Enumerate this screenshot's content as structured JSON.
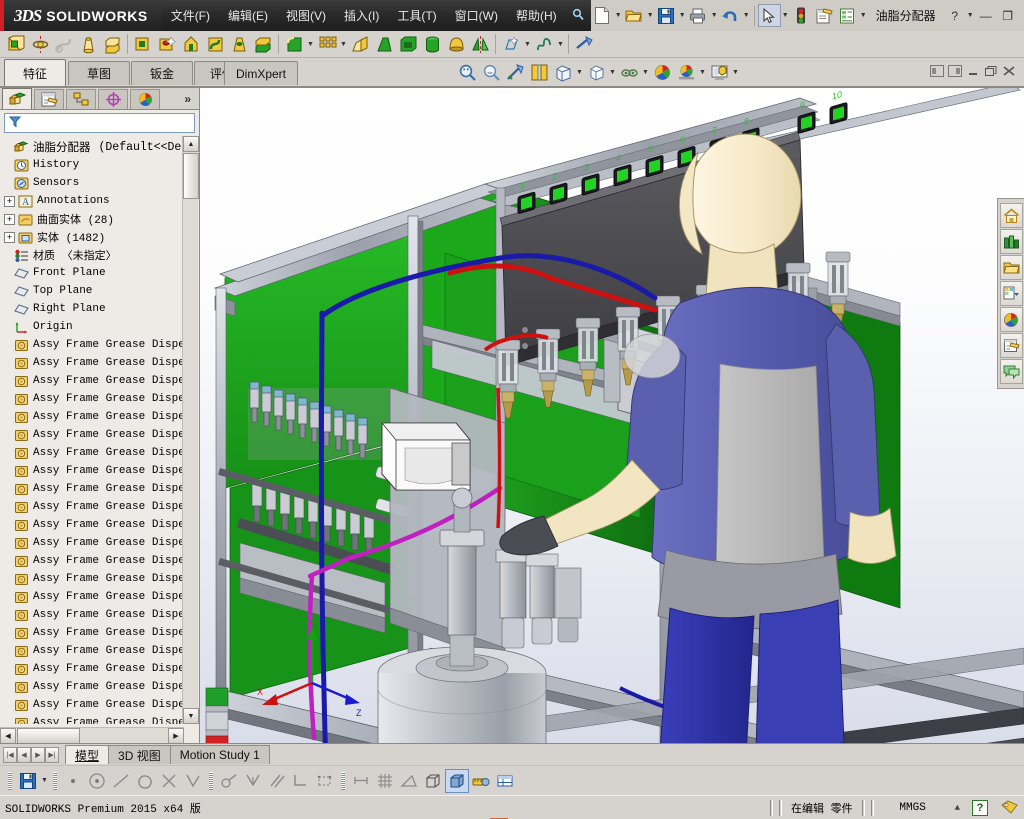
{
  "app": {
    "brand_ds": "3DS",
    "brand_name": "SOLIDWORKS",
    "document_name": "油脂分配器",
    "accent_red": "#cf2027",
    "titlebar_bg": "#2a2a2a"
  },
  "menu": [
    {
      "label": "文件(F)",
      "name": "menu-file"
    },
    {
      "label": "编辑(E)",
      "name": "menu-edit"
    },
    {
      "label": "视图(V)",
      "name": "menu-view"
    },
    {
      "label": "插入(I)",
      "name": "menu-insert"
    },
    {
      "label": "工具(T)",
      "name": "menu-tools"
    },
    {
      "label": "窗口(W)",
      "name": "menu-window"
    },
    {
      "label": "帮助(H)",
      "name": "menu-help"
    }
  ],
  "quick_access": [
    {
      "icon": "pin-icon",
      "label": "固定"
    },
    {
      "icon": "new-document-icon",
      "label": "新建"
    },
    {
      "icon": "open-folder-icon",
      "label": "打开"
    },
    {
      "icon": "save-icon",
      "label": "保存"
    },
    {
      "icon": "print-icon",
      "label": "打印"
    },
    {
      "icon": "undo-icon",
      "label": "撤消"
    },
    {
      "icon": "select-arrow-icon",
      "label": "选择"
    },
    {
      "icon": "rebuild-traffic-light-icon",
      "label": "重建模型"
    },
    {
      "icon": "options-gear-icon",
      "label": "选项"
    },
    {
      "icon": "list-properties-icon",
      "label": "自定义属性"
    }
  ],
  "window_buttons": {
    "help": "?",
    "minimize": "—",
    "restore": "❐",
    "close": "✕"
  },
  "features_toolbar": [
    {
      "icon": "extruded-boss-icon",
      "label": "拉伸凸台/基体"
    },
    {
      "icon": "revolved-boss-icon",
      "label": "旋转凸台/基体"
    },
    {
      "icon": "swept-boss-icon",
      "label": "扫描"
    },
    {
      "icon": "lofted-boss-icon",
      "label": "放样凸台/基体"
    },
    {
      "icon": "boundary-boss-icon",
      "label": "边界凸台/基体"
    },
    {
      "icon": "extruded-cut-icon",
      "label": "拉伸切除"
    },
    {
      "icon": "hole-wizard-icon",
      "label": "异型孔向导"
    },
    {
      "icon": "revolved-cut-icon",
      "label": "旋转切除"
    },
    {
      "icon": "swept-cut-icon",
      "label": "扫描切除"
    },
    {
      "icon": "lofted-cut-icon",
      "label": "放样切割"
    },
    {
      "icon": "boundary-cut-icon",
      "label": "边界切除"
    },
    {
      "icon": "fillet-icon",
      "label": "圆角"
    },
    {
      "icon": "linear-pattern-icon",
      "label": "线性阵列"
    },
    {
      "icon": "rib-icon",
      "label": "筋"
    },
    {
      "icon": "draft-icon",
      "label": "拔模"
    },
    {
      "icon": "shell-icon",
      "label": "抽壳"
    },
    {
      "icon": "wrap-icon",
      "label": "包覆"
    },
    {
      "icon": "dome-icon",
      "label": "圆顶"
    },
    {
      "icon": "mirror-icon",
      "label": "镜向"
    },
    {
      "icon": "reference-geometry-icon",
      "label": "参考几何体"
    },
    {
      "icon": "curves-icon",
      "label": "曲线"
    },
    {
      "icon": "instant3d-icon",
      "label": "Instant3D"
    }
  ],
  "command_tabs": [
    {
      "label": "特征",
      "name": "tab-features",
      "active": true
    },
    {
      "label": "草图",
      "name": "tab-sketch",
      "active": false
    },
    {
      "label": "钣金",
      "name": "tab-sheetmetal",
      "active": false
    },
    {
      "label": "评估",
      "name": "tab-evaluate",
      "active": false
    },
    {
      "label": "DimXpert",
      "name": "tab-dimxpert",
      "active": false
    }
  ],
  "view_toolbar": [
    {
      "icon": "zoom-to-fit-icon",
      "label": "整屏显示全图"
    },
    {
      "icon": "zoom-to-area-icon",
      "label": "局部放大"
    },
    {
      "icon": "previous-view-icon",
      "label": "上一视图"
    },
    {
      "icon": "section-view-icon",
      "label": "剖面视图"
    },
    {
      "icon": "view-orientation-icon",
      "label": "视图定向"
    },
    {
      "icon": "display-style-icon",
      "label": "显示样式"
    },
    {
      "icon": "hide-show-items-icon",
      "label": "隐藏/显示项目"
    },
    {
      "icon": "edit-appearance-icon",
      "label": "编辑外观"
    },
    {
      "icon": "apply-scene-icon",
      "label": "应用布景"
    },
    {
      "icon": "viewport-icon",
      "label": "视图设定"
    }
  ],
  "doc_window_buttons": [
    {
      "icon": "restore-left-icon",
      "label": "还原左"
    },
    {
      "icon": "restore-right-icon",
      "label": "还原右"
    },
    {
      "icon": "minimize-icon",
      "label": "最小化"
    },
    {
      "icon": "restore-icon",
      "label": "还原"
    },
    {
      "icon": "close-icon",
      "label": "关闭"
    }
  ],
  "feature_manager": {
    "tabs": [
      {
        "name": "featuremanager-tree-tab",
        "icon": "feature-tree-icon",
        "active": true
      },
      {
        "name": "propertymanager-tab",
        "icon": "property-manager-icon",
        "active": false
      },
      {
        "name": "configurationmanager-tab",
        "icon": "configuration-manager-icon",
        "active": false
      },
      {
        "name": "dimxpertmanager-tab",
        "icon": "dimxpert-manager-icon",
        "active": false
      },
      {
        "name": "displaymanager-tab",
        "icon": "display-manager-icon",
        "active": false
      }
    ],
    "expand_label": "»",
    "filter": {
      "placeholder": "",
      "value": ""
    },
    "root": {
      "label": "油脂分配器",
      "config": "(Default<<Defau",
      "icon": "part-icon"
    },
    "items": [
      {
        "label": "History",
        "icon": "history-icon",
        "expandable": false
      },
      {
        "label": "Sensors",
        "icon": "sensors-icon",
        "expandable": false
      },
      {
        "label": "Annotations",
        "icon": "annotations-icon",
        "expandable": true
      },
      {
        "label": "曲面实体 (28)",
        "icon": "surface-bodies-icon",
        "expandable": true
      },
      {
        "label": "实体 (1482)",
        "icon": "solid-bodies-icon",
        "expandable": true
      },
      {
        "label": "材质 〈未指定〉",
        "icon": "material-icon",
        "expandable": false
      },
      {
        "label": "Front Plane",
        "icon": "plane-icon",
        "expandable": false
      },
      {
        "label": "Top Plane",
        "icon": "plane-icon",
        "expandable": false
      },
      {
        "label": "Right Plane",
        "icon": "plane-icon",
        "expandable": false
      },
      {
        "label": "Origin",
        "icon": "origin-icon",
        "expandable": false
      },
      {
        "label": "Assy Frame Grease Disper",
        "icon": "body-icon",
        "expandable": false
      },
      {
        "label": "Assy Frame Grease Disper",
        "icon": "body-icon",
        "expandable": false
      },
      {
        "label": "Assy Frame Grease Disper",
        "icon": "body-icon",
        "expandable": false
      },
      {
        "label": "Assy Frame Grease Disper",
        "icon": "body-icon",
        "expandable": false
      },
      {
        "label": "Assy Frame Grease Disper",
        "icon": "body-icon",
        "expandable": false
      },
      {
        "label": "Assy Frame Grease Disper",
        "icon": "body-icon",
        "expandable": false
      },
      {
        "label": "Assy Frame Grease Disper",
        "icon": "body-icon",
        "expandable": false
      },
      {
        "label": "Assy Frame Grease Disper",
        "icon": "body-icon",
        "expandable": false
      },
      {
        "label": "Assy Frame Grease Disper",
        "icon": "body-icon",
        "expandable": false
      },
      {
        "label": "Assy Frame Grease Disper",
        "icon": "body-icon",
        "expandable": false
      },
      {
        "label": "Assy Frame Grease Disper",
        "icon": "body-icon",
        "expandable": false
      },
      {
        "label": "Assy Frame Grease Disper",
        "icon": "body-icon",
        "expandable": false
      },
      {
        "label": "Assy Frame Grease Disper",
        "icon": "body-icon",
        "expandable": false
      },
      {
        "label": "Assy Frame Grease Disper",
        "icon": "body-icon",
        "expandable": false
      },
      {
        "label": "Assy Frame Grease Disper",
        "icon": "body-icon",
        "expandable": false
      },
      {
        "label": "Assy Frame Grease Disper",
        "icon": "body-icon",
        "expandable": false
      },
      {
        "label": "Assy Frame Grease Disper",
        "icon": "body-icon",
        "expandable": false
      },
      {
        "label": "Assy Frame Grease Disper",
        "icon": "body-icon",
        "expandable": false
      },
      {
        "label": "Assy Frame Grease Disper",
        "icon": "body-icon",
        "expandable": false
      },
      {
        "label": "Assy Frame Grease Disper",
        "icon": "body-icon",
        "expandable": false
      },
      {
        "label": "Assy Frame Grease Disper",
        "icon": "body-icon",
        "expandable": false
      },
      {
        "label": "Assy Frame Grease Disper",
        "icon": "body-icon",
        "expandable": false
      },
      {
        "label": "Assy Frame Grease Disper",
        "icon": "body-icon",
        "expandable": false
      }
    ]
  },
  "task_pane": [
    {
      "icon": "home-icon",
      "label": "SOLIDWORKS 资源"
    },
    {
      "icon": "design-library-icon",
      "label": "设计库"
    },
    {
      "icon": "file-explorer-icon",
      "label": "文件探索器"
    },
    {
      "icon": "view-palette-icon",
      "label": "视图调色板"
    },
    {
      "icon": "appearances-icon",
      "label": "外观、布景和贴图"
    },
    {
      "icon": "custom-properties-icon",
      "label": "自定义属性"
    },
    {
      "icon": "solidworks-forum-icon",
      "label": "SOLIDWORKS 论坛"
    }
  ],
  "bottom_tabs": {
    "nav": [
      "|◀",
      "◀",
      "▶",
      "▶|"
    ],
    "tabs": [
      {
        "label": "模型",
        "name": "tab-model",
        "active": true
      },
      {
        "label": "3D 视图",
        "name": "tab-3dviews",
        "active": false
      },
      {
        "label": "Motion Study 1",
        "name": "tab-motion-study",
        "active": false
      }
    ]
  },
  "snap_toolbar": [
    {
      "icon": "save-icon",
      "label": "保存"
    },
    {
      "icon": "point-snap-icon",
      "label": "点"
    },
    {
      "icon": "center-point-snap-icon",
      "label": "中心点"
    },
    {
      "icon": "midpoint-snap-icon",
      "label": "中点"
    },
    {
      "icon": "quadrant-snap-icon",
      "label": "象限点"
    },
    {
      "icon": "intersection-snap-icon",
      "label": "交叉点"
    },
    {
      "icon": "nearest-snap-icon",
      "label": "最近点"
    },
    {
      "icon": "tangent-snap-icon",
      "label": "相切"
    },
    {
      "icon": "perpendicular-snap-icon",
      "label": "垂直"
    },
    {
      "icon": "parallel-snap-icon",
      "label": "平行"
    },
    {
      "icon": "horizontal-vertical-snap-icon",
      "label": "水平/竖直"
    },
    {
      "icon": "grid-snap-icon",
      "label": "栅格"
    },
    {
      "icon": "length-snap-icon",
      "label": "长度"
    },
    {
      "icon": "grid-display-icon",
      "label": "网格"
    },
    {
      "icon": "angle-snap-icon",
      "label": "角度"
    },
    {
      "icon": "wireframe-icon",
      "label": "线架图"
    },
    {
      "icon": "shaded-with-edges-icon",
      "label": "带边线上色",
      "pressed": true
    },
    {
      "icon": "measure-icon",
      "label": "测量"
    },
    {
      "icon": "design-table-icon",
      "label": "设计表"
    }
  ],
  "status_bar": {
    "left_text": "SOLIDWORKS Premium 2015 x64 版",
    "edit_state": "在编辑 零件",
    "units": "MMGS",
    "overlay_toggle": "▲",
    "help_badge": "?",
    "tag_icon": "tag-icon"
  },
  "model": {
    "description": "油脂分配器 3D 装配模型",
    "indicator_labels": [
      "1",
      "2",
      "3",
      "4",
      "5",
      "6",
      "7",
      "8",
      "9",
      "10"
    ],
    "colors": {
      "panel_green": "#1e9e1e",
      "frame_gray": "#a8adb8",
      "tube_blue": "#1a1aa8",
      "tube_red": "#cc1111",
      "tube_magenta": "#c020c0",
      "tube_cyan": "#20b8c8",
      "mannequin_skin": "#f7ecd0",
      "mannequin_shirt": "#5a5fae",
      "mannequin_gray": "#b6b6b6",
      "mannequin_pants": "#2b2f9e",
      "panel_dark": "#4e4e52",
      "display_blue": "#1a1a80"
    }
  }
}
